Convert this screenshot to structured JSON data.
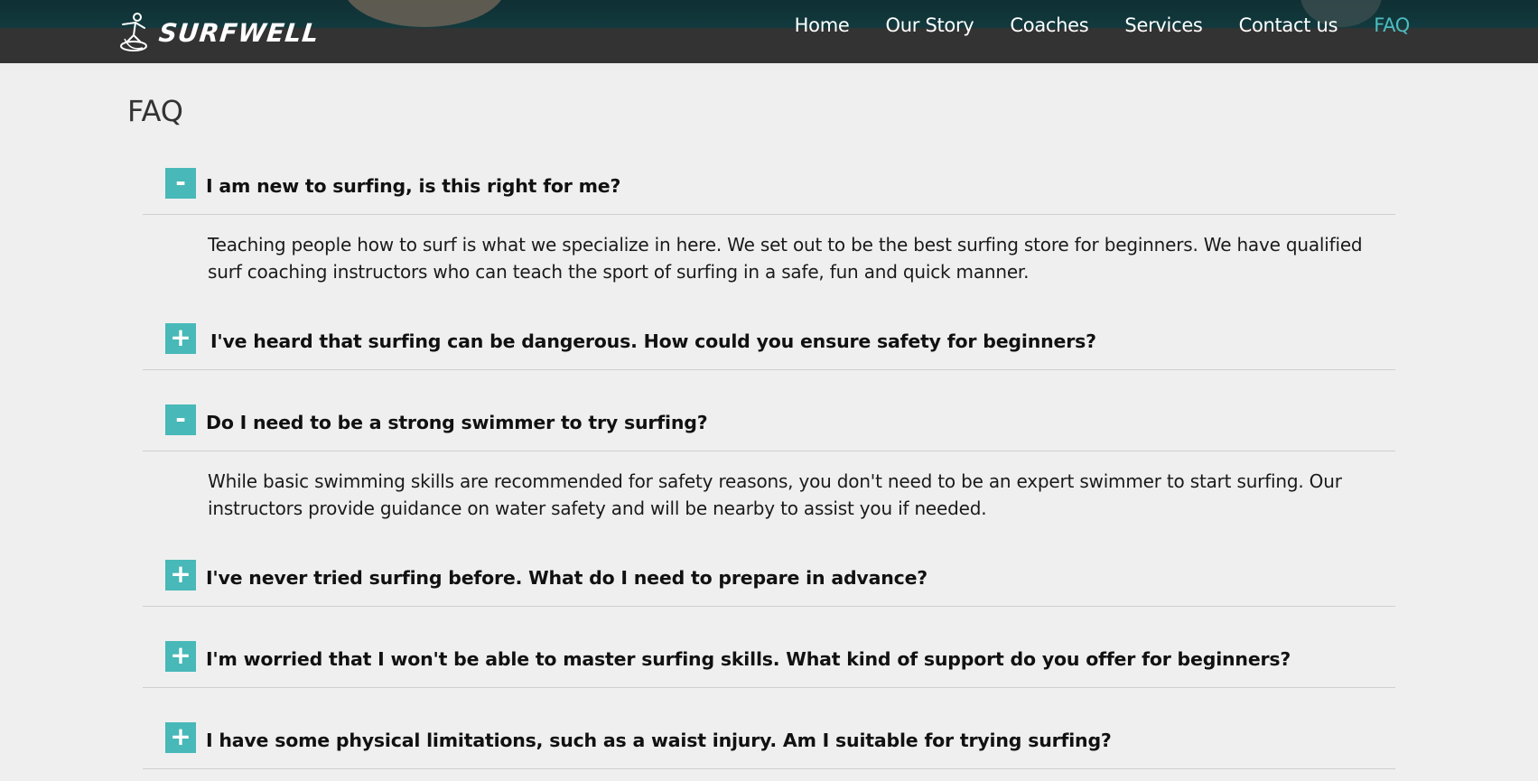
{
  "brand": {
    "name": "SURFWELL",
    "logo_icon": "surfer-icon"
  },
  "nav": {
    "items": [
      {
        "label": "Home"
      },
      {
        "label": "Our Story"
      },
      {
        "label": "Coaches"
      },
      {
        "label": "Services"
      },
      {
        "label": "Contact us"
      },
      {
        "label": "FAQ",
        "active": true
      }
    ],
    "active_color": "#4dbcc0"
  },
  "page": {
    "title": "FAQ"
  },
  "faq": {
    "accent_color": "#48b8b8",
    "items": [
      {
        "question": "I am new to surfing, is this right for me?",
        "expanded": true,
        "toggle": "-",
        "answer": "Teaching people how to surf is what we specialize in here. We set out to be the best surfing store for beginners. We have qualified surf coaching instructors who can teach the sport of surfing in a safe, fun and quick manner."
      },
      {
        "question": "I've heard that surfing can be dangerous. How could you ensure safety for beginners?",
        "expanded": false,
        "toggle": "+"
      },
      {
        "question": "Do I need to be a strong swimmer to try surfing?",
        "expanded": true,
        "toggle": "-",
        "answer": "While basic swimming skills are recommended for safety reasons, you don't need to be an expert swimmer to start surfing. Our instructors provide guidance on water safety and will be nearby to assist you if needed."
      },
      {
        "question": "I've never tried surfing before. What do I need to prepare in advance?",
        "expanded": false,
        "toggle": "+"
      },
      {
        "question": "I'm worried that I won't be able to master surfing skills. What kind of support do you offer for beginners?",
        "expanded": false,
        "toggle": "+"
      },
      {
        "question": "I have some physical limitations, such as a waist injury. Am I suitable for trying surfing?",
        "expanded": false,
        "toggle": "+"
      }
    ]
  }
}
